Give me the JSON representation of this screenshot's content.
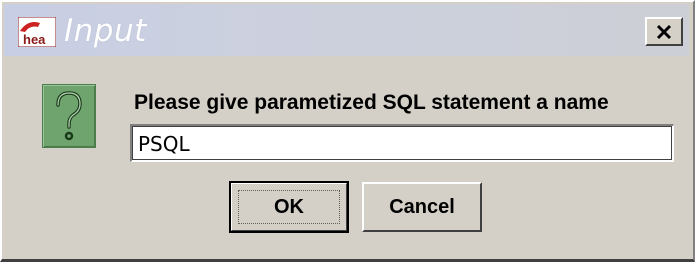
{
  "window": {
    "title": "Input",
    "app_icon": "hea-logo-icon",
    "close_icon": "close-icon"
  },
  "dialog": {
    "icon": "question-icon",
    "message": "Please give parametized SQL statement a name",
    "input_value": "PSQL"
  },
  "buttons": {
    "ok_label": "OK",
    "cancel_label": "Cancel"
  },
  "colors": {
    "background": "#d4d0c8",
    "icon_green": "#6fa46f"
  }
}
